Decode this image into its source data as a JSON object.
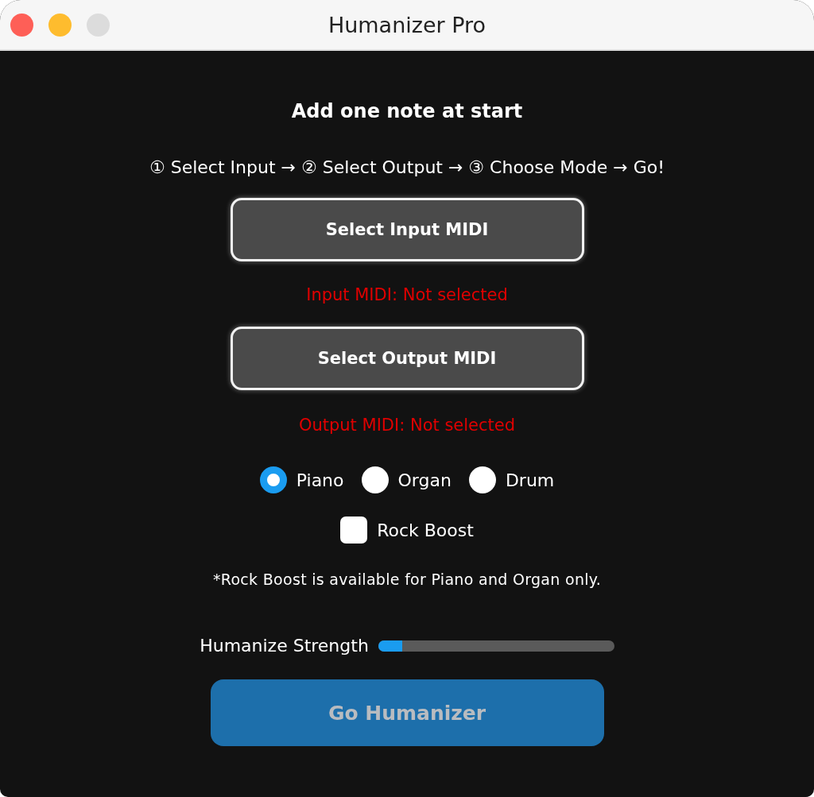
{
  "window": {
    "title": "Humanizer Pro"
  },
  "heading": "Add one note at start",
  "steps": "① Select Input → ② Select Output → ③ Choose Mode → Go!",
  "input": {
    "button": "Select Input MIDI",
    "status": "Input MIDI: Not selected"
  },
  "output": {
    "button": "Select Output MIDI",
    "status": "Output MIDI: Not selected"
  },
  "modes": [
    {
      "label": "Piano",
      "selected": true
    },
    {
      "label": "Organ",
      "selected": false
    },
    {
      "label": "Drum",
      "selected": false
    }
  ],
  "rock_boost": {
    "label": "Rock Boost",
    "checked": false
  },
  "note": "*Rock Boost is available for Piano and Organ only.",
  "strength": {
    "label": "Humanize Strength",
    "level": 0.1
  },
  "go_button": {
    "label": "Go Humanizer",
    "disabled": true
  }
}
